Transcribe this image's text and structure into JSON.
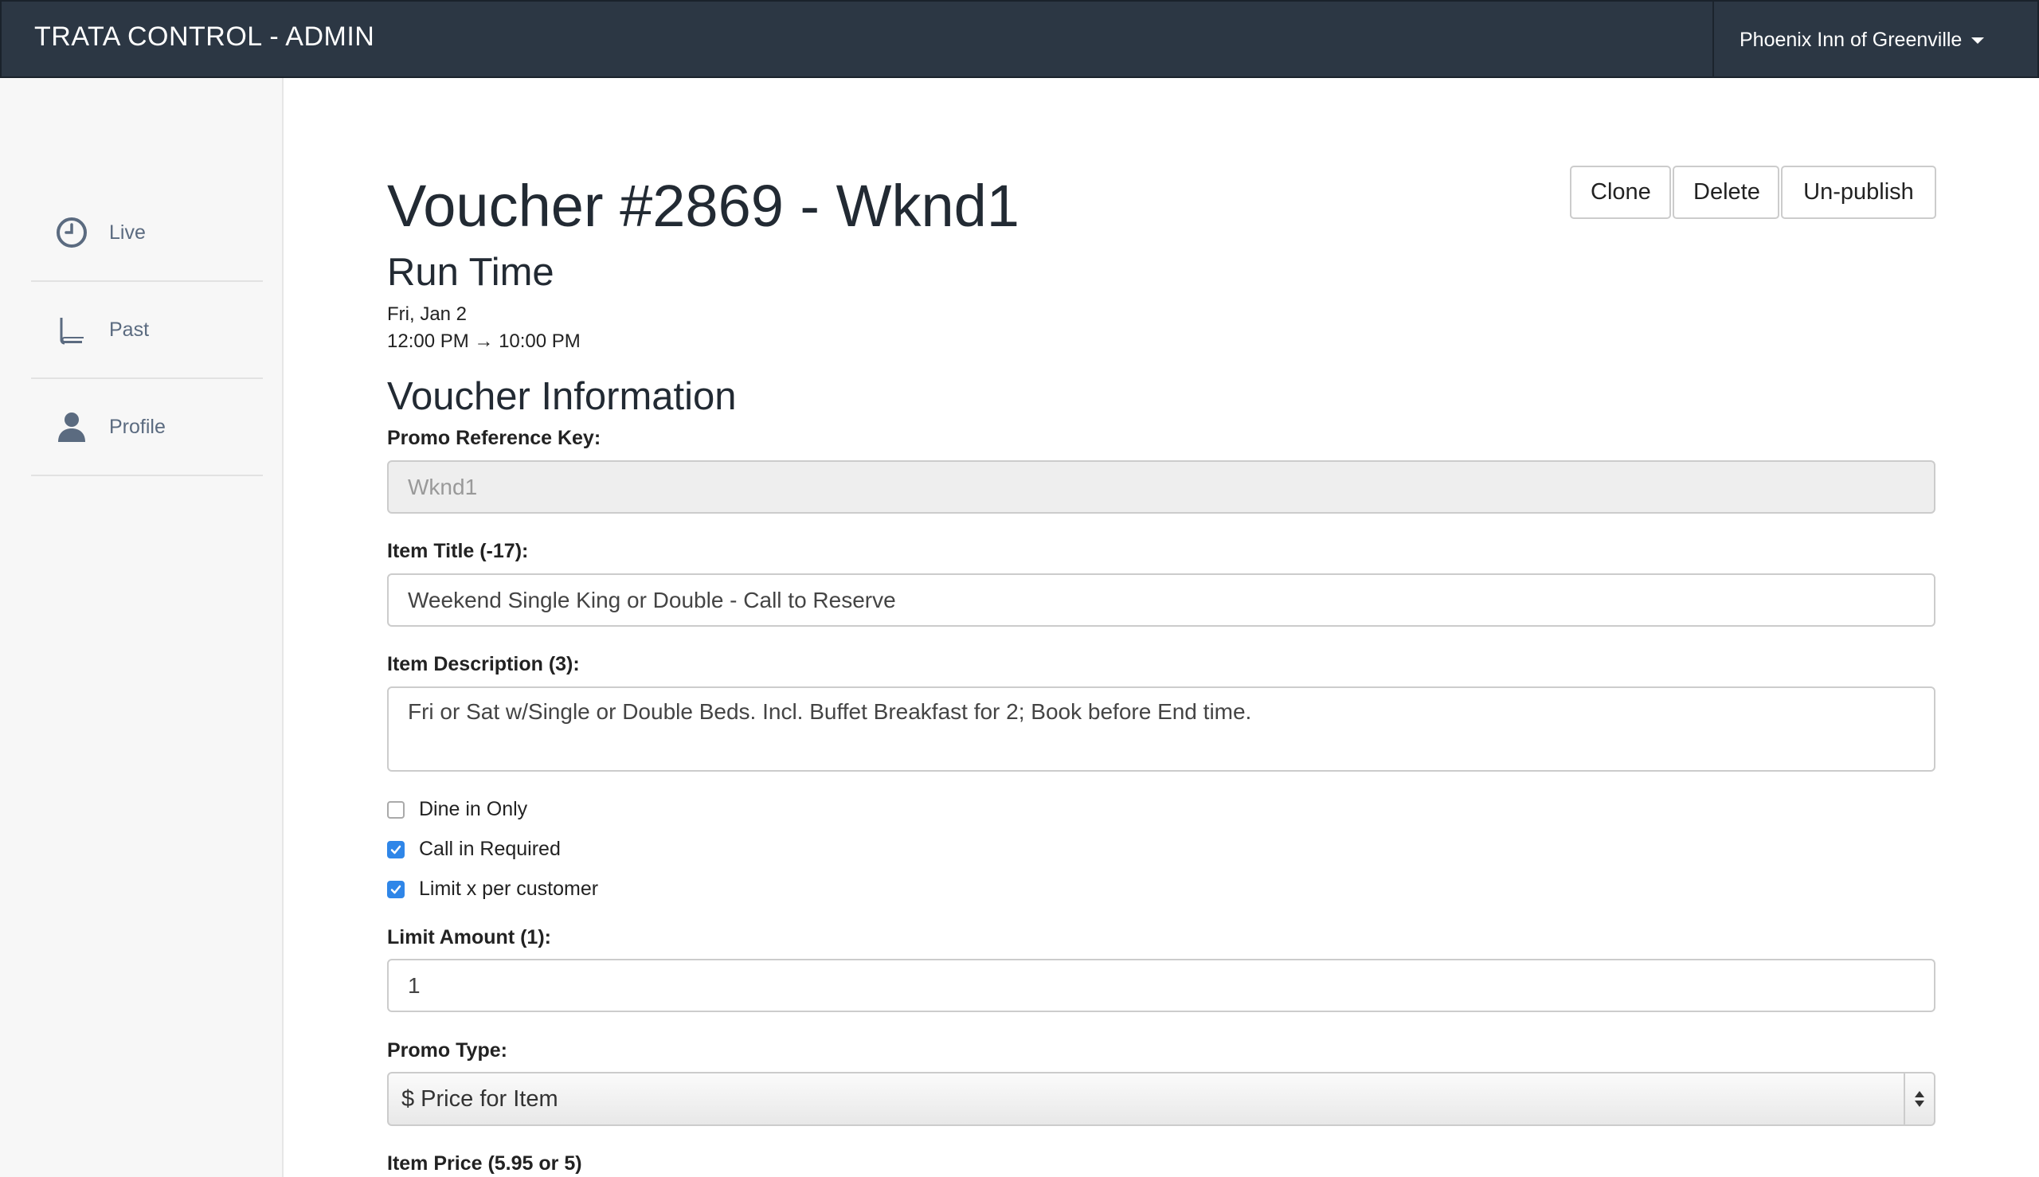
{
  "app": {
    "title": "TRATA CONTROL - ADMIN",
    "property": "Phoenix Inn of Greenville"
  },
  "sidebar": {
    "items": [
      {
        "label": "Live",
        "icon": "clock-icon"
      },
      {
        "label": "Past",
        "icon": "book-icon"
      },
      {
        "label": "Profile",
        "icon": "user-icon"
      }
    ]
  },
  "page": {
    "title": "Voucher #2869 - Wknd1",
    "actions": {
      "clone": "Clone",
      "delete": "Delete",
      "unpublish": "Un-publish"
    },
    "run_time": {
      "heading": "Run Time",
      "date": "Fri, Jan 2",
      "time": "12:00 PM → 10:00 PM"
    },
    "info": {
      "heading": "Voucher Information",
      "promo_key_label": "Promo Reference Key:",
      "promo_key_value": "Wknd1",
      "item_title_label": "Item Title (-17):",
      "item_title_value": "Weekend Single King or Double - Call to Reserve",
      "item_desc_label": "Item Description (3):",
      "item_desc_value": "Fri or Sat w/Single or Double Beds. Incl. Buffet Breakfast for 2; Book before End time.",
      "checkboxes": [
        {
          "label": "Dine in Only",
          "checked": false
        },
        {
          "label": "Call in Required",
          "checked": true
        },
        {
          "label": "Limit x per customer",
          "checked": true
        }
      ],
      "limit_label": "Limit Amount (1):",
      "limit_value": "1",
      "promo_type_label": "Promo Type:",
      "promo_type_value": "$ Price for Item",
      "item_price_label": "Item Price (5.95 or 5)"
    }
  },
  "colors": {
    "navbar": "#2c3744",
    "accent": "#2f86e8",
    "sidebar_text": "#5b6b80"
  }
}
